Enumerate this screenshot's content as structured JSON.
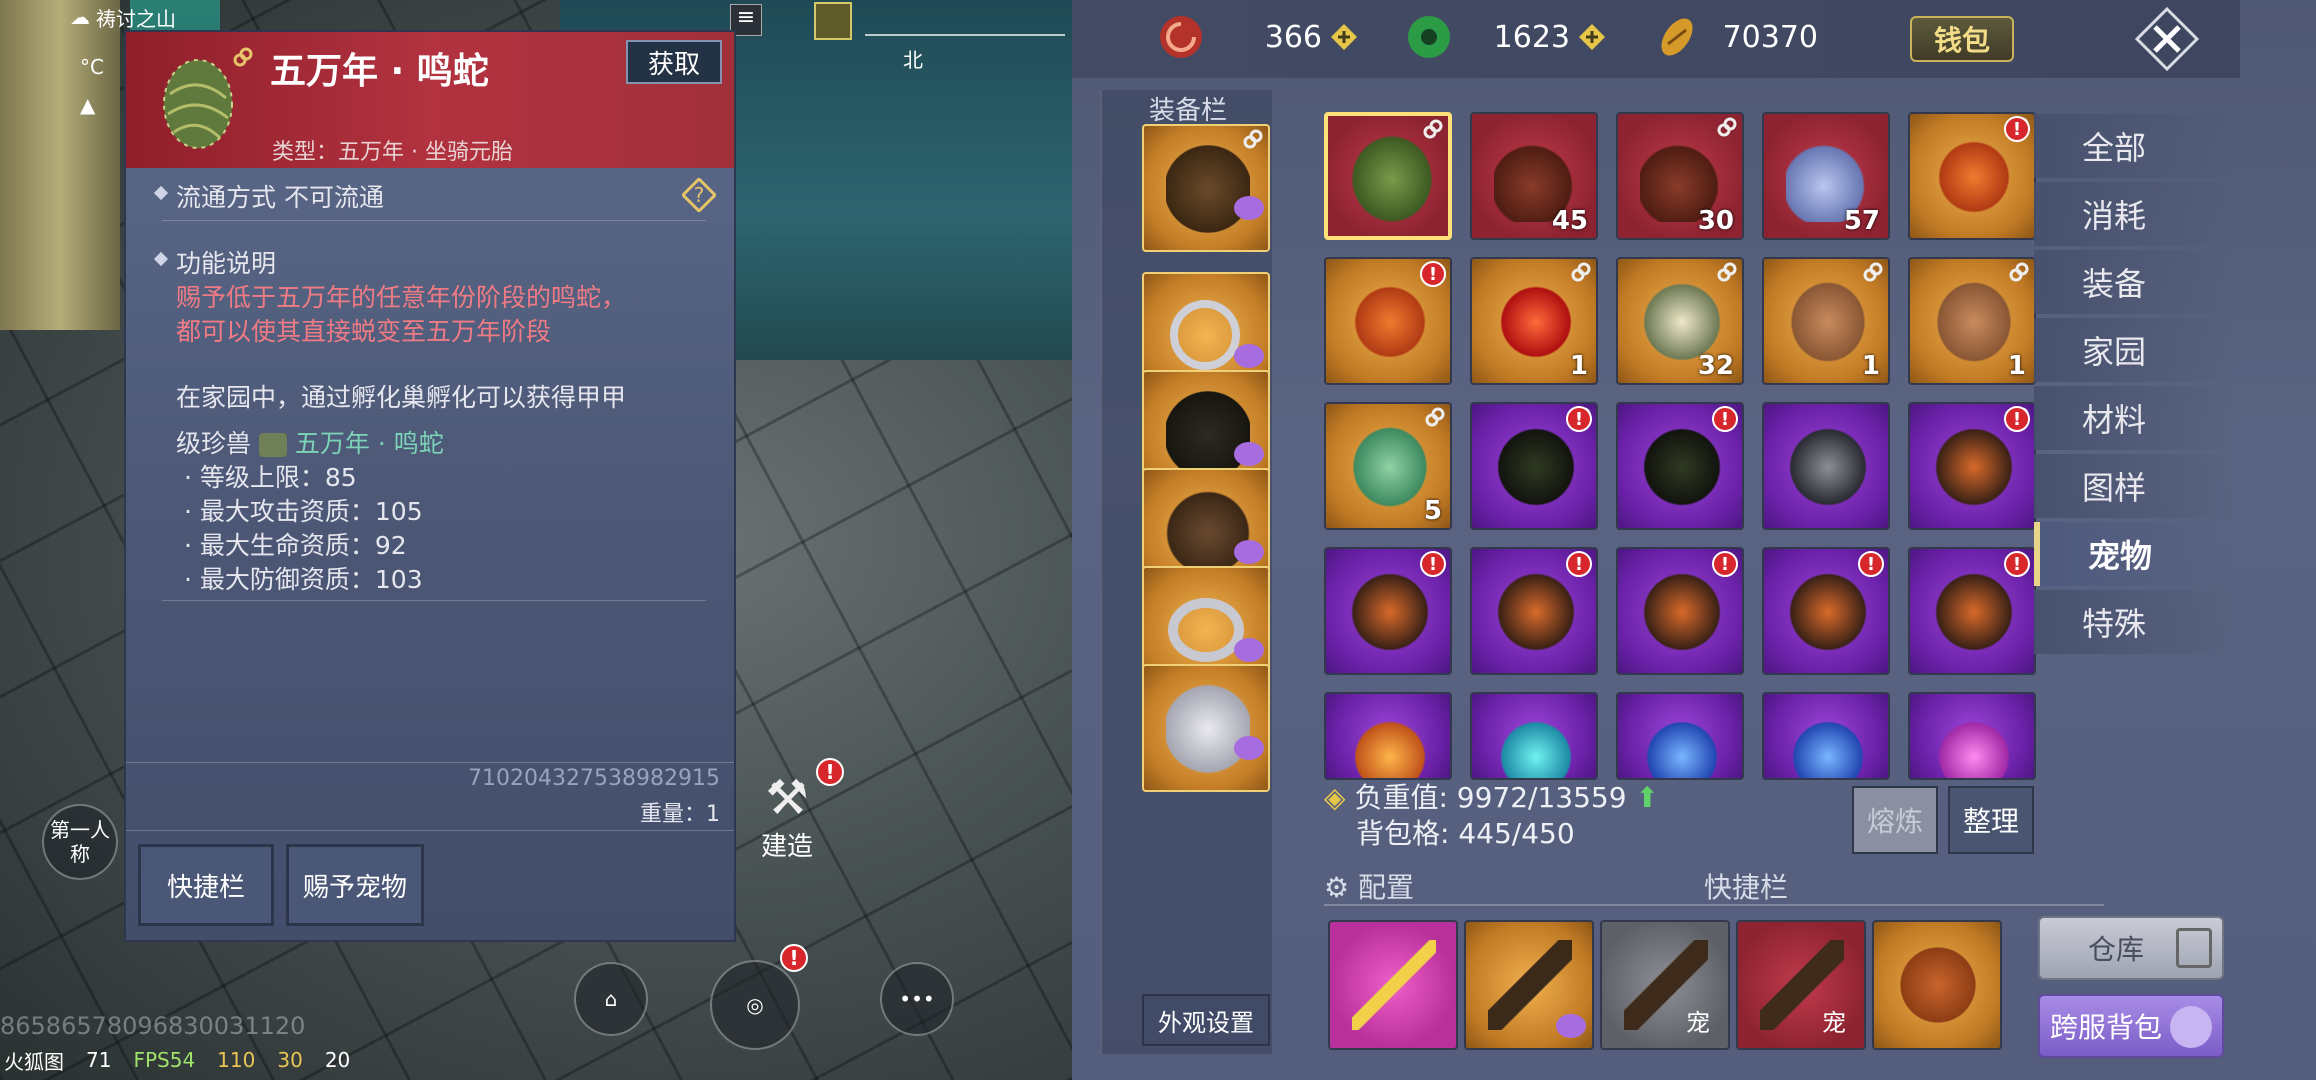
{
  "hud": {
    "location": "祷讨之山",
    "temp": "°C",
    "compass_north": "北",
    "first_person": "第一人称",
    "build": "建造",
    "watermark": "86586578096830031120",
    "app_name": "火狐图",
    "fps_label": "FPS54",
    "signal": "110",
    "flag_count": "30",
    "eye_count": "20",
    "battery": "71"
  },
  "tooltip": {
    "title": "五万年 · 鸣蛇",
    "get_button": "获取",
    "type_line": "类型：五万年 · 坐骑元胎",
    "circulation": "流通方式   不可流通",
    "func_title": "功能说明",
    "func_red_1": "赐予低于五万年的任意年份阶段的鸣蛇，",
    "func_red_2": "都可以使其直接蜕变至五万年阶段",
    "hatch_1": "在家园中，通过孵化巢孵化可以获得甲甲",
    "hatch_2_prefix": "级珍兽",
    "hatch_2_name": "五万年 · 鸣蛇",
    "stat_1": "· 等级上限：85",
    "stat_2": "· 最大攻击资质：105",
    "stat_3": "· 最大生命资质：92",
    "stat_4": "· 最大防御资质：103",
    "item_id": "710204327538982915",
    "weight": "重量：1",
    "shortcut_button": "快捷栏",
    "give_pet_button": "赐予宠物"
  },
  "currency": {
    "c1": "366",
    "c2": "1623",
    "c3": "70370",
    "wallet": "钱包"
  },
  "equip": {
    "title": "装备栏",
    "appearance": "外观设置"
  },
  "grid": {
    "counts": [
      "",
      "45",
      "30",
      "57",
      "",
      "",
      "1",
      "32",
      "1",
      "1",
      "5",
      "",
      "",
      "",
      "",
      "",
      "",
      "",
      "",
      "",
      "",
      "",
      "",
      "",
      ""
    ]
  },
  "status": {
    "load": "负重值: 9972/13559",
    "slots": "背包格: 445/450",
    "smelt": "熔炼",
    "sort": "整理",
    "config": "配置",
    "quickbar": "快捷栏",
    "pet_tag": "宠"
  },
  "tabs": [
    "全部",
    "消耗",
    "装备",
    "家园",
    "材料",
    "图样",
    "宠物",
    "特殊"
  ],
  "storage": "仓库",
  "cross_bag": "跨服背包",
  "colors": {
    "accent": "#ffe17a",
    "tooltip_head": "#a1303b",
    "badge": "#d7272c"
  }
}
